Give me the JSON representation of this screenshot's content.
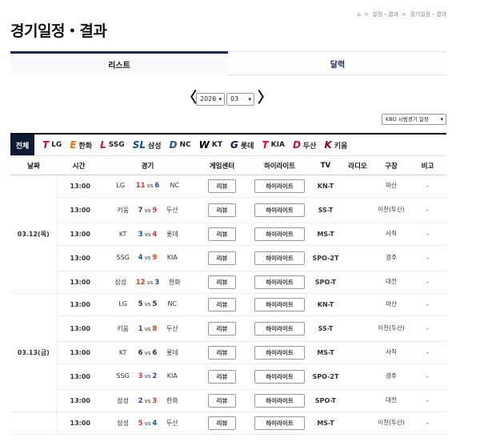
{
  "breadcrumb": [
    "⌂",
    ">",
    "일정・결과",
    ">",
    "경기일정・결과"
  ],
  "page_title": "경기일정・결과",
  "tabs": [
    {
      "label": "리스트"
    },
    {
      "label": "달력"
    }
  ],
  "datenav": {
    "prev": "〈",
    "next": "〉",
    "year": "2026",
    "month": "03"
  },
  "game_type": "KBO 시범경기 일정",
  "team_filters": {
    "all": "전체",
    "teams": [
      {
        "logo": "T",
        "name": "LG",
        "color": "#c30452"
      },
      {
        "logo": "E",
        "name": "한화",
        "color": "#ff6600"
      },
      {
        "logo": "L",
        "name": "SSG",
        "color": "#ce0e2d"
      },
      {
        "logo": "SL",
        "name": "삼성",
        "color": "#074ca1"
      },
      {
        "logo": "D",
        "name": "NC",
        "color": "#315288"
      },
      {
        "logo": "W",
        "name": "KT",
        "color": "#000000"
      },
      {
        "logo": "G",
        "name": "롯데",
        "color": "#041e42"
      },
      {
        "logo": "T",
        "name": "KIA",
        "color": "#ea0029"
      },
      {
        "logo": "D",
        "name": "두산",
        "color": "#cc0f2f"
      },
      {
        "logo": "K",
        "name": "키움",
        "color": "#820024"
      }
    ]
  },
  "columns": [
    "날짜",
    "시간",
    "경기",
    "게임센터",
    "하이라이트",
    "TV",
    "라디오",
    "구장",
    "비고"
  ],
  "days": [
    {
      "date": "03.12(목)",
      "games": [
        {
          "time": "13:00",
          "away": "LG",
          "away_score": "11",
          "vs": "vs",
          "home_score": "6",
          "home": "NC",
          "recap": "리뷰",
          "highlight": "하이라이트",
          "tv": "KN-T",
          "radio": "",
          "stadium": "마산",
          "note": "-",
          "away_res": "win",
          "home_res": "lose"
        },
        {
          "time": "13:00",
          "away": "키움",
          "away_score": "7",
          "vs": "vs",
          "home_score": "9",
          "home": "두산",
          "recap": "리뷰",
          "highlight": "하이라이트",
          "tv": "SS-T",
          "radio": "",
          "stadium": "이천(두산)",
          "note": "-",
          "away_res": "lose",
          "home_res": "win"
        },
        {
          "time": "13:00",
          "away": "KT",
          "away_score": "3",
          "vs": "vs",
          "home_score": "4",
          "home": "롯데",
          "recap": "리뷰",
          "highlight": "하이라이트",
          "tv": "MS-T",
          "radio": "",
          "stadium": "사직",
          "note": "-",
          "away_res": "lose",
          "home_res": "win"
        },
        {
          "time": "13:00",
          "away": "SSG",
          "away_score": "4",
          "vs": "vs",
          "home_score": "9",
          "home": "KIA",
          "recap": "리뷰",
          "highlight": "하이라이트",
          "tv": "SPO-2T",
          "radio": "",
          "stadium": "광주",
          "note": "-",
          "away_res": "lose",
          "home_res": "win"
        },
        {
          "time": "13:00",
          "away": "삼성",
          "away_score": "12",
          "vs": "vs",
          "home_score": "3",
          "home": "한화",
          "recap": "리뷰",
          "highlight": "하이라이트",
          "tv": "SPO-T",
          "radio": "",
          "stadium": "대전",
          "note": "-",
          "away_res": "win",
          "home_res": "lose"
        }
      ]
    },
    {
      "date": "03.13(금)",
      "games": [
        {
          "time": "13:00",
          "away": "LG",
          "away_score": "5",
          "vs": "vs",
          "home_score": "5",
          "home": "NC",
          "recap": "리뷰",
          "highlight": "하이라이트",
          "tv": "KN-T",
          "radio": "",
          "stadium": "마산",
          "note": "-",
          "away_res": "draw",
          "home_res": "draw"
        },
        {
          "time": "13:00",
          "away": "키움",
          "away_score": "1",
          "vs": "vs",
          "home_score": "8",
          "home": "두산",
          "recap": "리뷰",
          "highlight": "하이라이트",
          "tv": "SS-T",
          "radio": "",
          "stadium": "이천(두산)",
          "note": "-",
          "away_res": "lose",
          "home_res": "win"
        },
        {
          "time": "13:00",
          "away": "KT",
          "away_score": "6",
          "vs": "vs",
          "home_score": "6",
          "home": "롯데",
          "recap": "리뷰",
          "highlight": "하이라이트",
          "tv": "MS-T",
          "radio": "",
          "stadium": "사직",
          "note": "-",
          "away_res": "draw",
          "home_res": "draw"
        },
        {
          "time": "13:00",
          "away": "SSG",
          "away_score": "3",
          "vs": "vs",
          "home_score": "2",
          "home": "KIA",
          "recap": "리뷰",
          "highlight": "하이라이트",
          "tv": "SPO-2T",
          "radio": "",
          "stadium": "광주",
          "note": "-",
          "away_res": "win",
          "home_res": "lose"
        },
        {
          "time": "13:00",
          "away": "삼성",
          "away_score": "2",
          "vs": "vs",
          "home_score": "3",
          "home": "한화",
          "recap": "리뷰",
          "highlight": "하이라이트",
          "tv": "SPO-T",
          "radio": "",
          "stadium": "대전",
          "note": "-",
          "away_res": "lose",
          "home_res": "win"
        }
      ]
    },
    {
      "date": "",
      "games": [
        {
          "time": "13:00",
          "away": "삼성",
          "away_score": "5",
          "vs": "vs",
          "home_score": "4",
          "home": "두산",
          "recap": "리뷰",
          "highlight": "하이라이트",
          "tv": "MS-T",
          "radio": "",
          "stadium": "이천(두산)",
          "note": "-",
          "away_res": "win",
          "home_res": "lose"
        }
      ]
    }
  ]
}
